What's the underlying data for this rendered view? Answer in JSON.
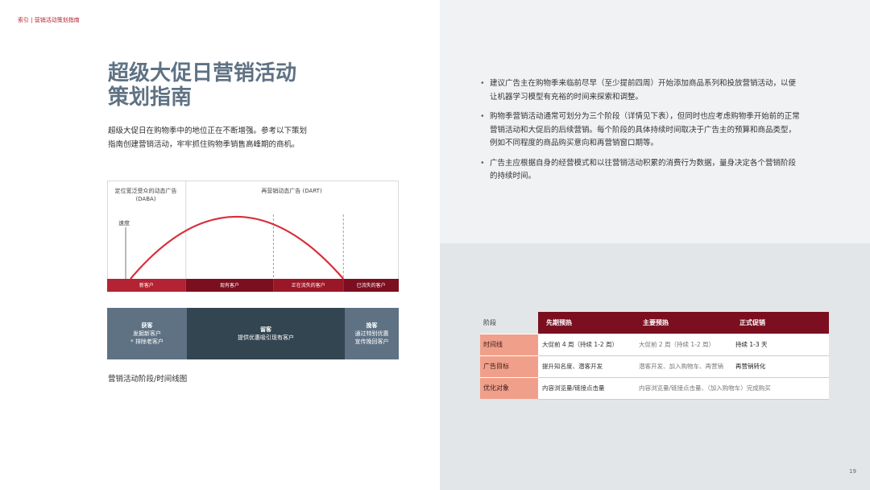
{
  "breadcrumb": "索引 | 营销活动策划指南",
  "title_line1": "超级大促日营销活动",
  "title_line2": "策划指南",
  "intro_line1": "超级大促日在购物季中的地位正在不断增强。参考以下策划",
  "intro_line2": "指南创建营销活动，牢牢抓住购物季销售高峰期的商机。",
  "chart_data": {
    "type": "area",
    "dim_labels": {
      "left_title_line1": "定位宽泛受众的动态广告",
      "left_title_line2": "(DABA)",
      "right_title": "再营销动态广告 (DART)",
      "y_label": "速度"
    },
    "segments": [
      {
        "label": "新客户",
        "start": 0,
        "end": 0.27
      },
      {
        "label": "现有客户",
        "start": 0.27,
        "end": 0.57
      },
      {
        "label": "正在流失的客户",
        "start": 0.57,
        "end": 0.81
      },
      {
        "label": "已流失的客户",
        "start": 0.81,
        "end": 1.0
      }
    ],
    "curve": {
      "x": [
        0.08,
        0.44,
        0.81
      ],
      "peak": 0.47
    },
    "dividers": [
      0.27,
      0.57,
      0.81
    ],
    "colors": {
      "curve": "#d92d3a",
      "bar_new": "#b32333",
      "bar_existing": "#7b0f1f",
      "bar_losing": "#9a1727",
      "bar_lost": "#7b0f1f"
    }
  },
  "phases": [
    {
      "title": "获客",
      "line1": "发掘新客户",
      "line2": "* 排除老客户"
    },
    {
      "title": "留客",
      "line1": "提供优惠吸引现有客户",
      "line2": ""
    },
    {
      "title": "挽客",
      "line1": "通过特别优惠",
      "line2": "宣传挽回客户"
    }
  ],
  "caption": "营销活动阶段/时间线图",
  "bullets": [
    {
      "line1": "建议广告主在购物季来临前尽早（至少提前四周）开始添加商品系列和投放营销活动，以便",
      "line2": "让机器学习模型有充裕的时间来探索和调整。",
      "line3": ""
    },
    {
      "line1": "购物季营销活动通常可划分为三个阶段（详情见下表），但同时也应考虑购物季开始前的正常",
      "line2": "营销活动和大促后的后续营销。每个阶段的具体持续时间取决于广告主的预算和商品类型，",
      "line3": "例如不同程度的商品购买意向和再营销窗口期等。"
    },
    {
      "line1": "广告主应根据自身的经营模式和以往营销活动积累的消费行为数据，量身决定各个营销阶段",
      "line2": "的持续时间。",
      "line3": ""
    }
  ],
  "table": {
    "headers": [
      "阶段",
      "先期预热",
      "主要预热",
      "正式促销"
    ],
    "rows": [
      {
        "label": "时间线",
        "cells": [
          "大促前 4 周（持续 1-2 周）",
          "大促前 2 周（持续 1-2 周）",
          "持续 1-3 天"
        ]
      },
      {
        "label": "广告目标",
        "cells": [
          "提升知名度、潜客开发",
          "潜客开发、加入购物车、再营销",
          "再营销转化"
        ]
      },
      {
        "label": "优化对象",
        "cells": [
          "内容浏览量/链接点击量",
          "内容浏览量/链接点击量、（加入购物车）完成购买",
          ""
        ]
      }
    ]
  },
  "page_number": "19"
}
